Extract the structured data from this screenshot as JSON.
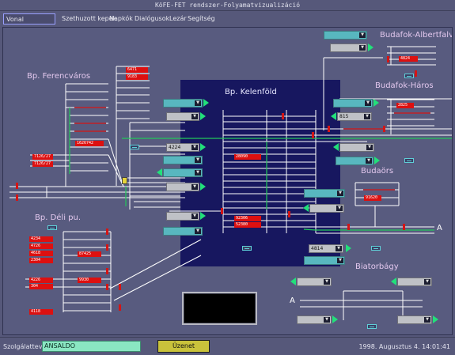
{
  "window": {
    "title": "KöFE-FET rendszer-Folyamatvizualizáció"
  },
  "menu": [
    {
      "label": "Vonal szakaszok",
      "active": true
    },
    {
      "label": "Szethuzott kepek"
    },
    {
      "label": "Napkók"
    },
    {
      "label": "Dialógusok"
    },
    {
      "label": "Lezár"
    },
    {
      "label": "Segítség"
    }
  ],
  "stations": {
    "ferencvaros": "Bp. Ferencváros",
    "kelenfold": "Bp. Kelenföld",
    "deli": "Bp. Déli pu.",
    "albertfalva": "Budafok-Albertfalva",
    "haros": "Budafok-Háros",
    "budaors": "Budaörs",
    "biatorbagy": "Biatorbágy"
  },
  "train_numbers": {
    "ferenc_top1": "6471",
    "ferenc_top2": "9183",
    "ferenc_mid": "1626742",
    "ferenc_left1": "7126/27",
    "ferenc_left2": "7126/27",
    "deli_1": "4234",
    "deli_2": "4726",
    "deli_3": "4618",
    "deli_4": "2304",
    "deli_5": "87425",
    "deli_6": "4226",
    "deli_7": "304",
    "deli_8": "9930",
    "deli_9": "4118",
    "kel_1": "28090",
    "kel_2": "92306",
    "kel_3": "52380",
    "albertfalva": "4824",
    "haros": "2825",
    "budaors": "91620"
  },
  "dropdowns": {
    "kel_4224": "4224",
    "haros_815": "815",
    "budaors_4814": "4814"
  },
  "marker_a": "A",
  "status": {
    "operator_label": "Szolgálattevő:",
    "operator_value": "ANSALDO",
    "message_button": "Üzenet",
    "datetime": "1998. Augusztus  4. 14:01:41"
  },
  "colors": {
    "kelenfold_box": "#17175f",
    "track": "#ffffff",
    "occupied": "#dd1010",
    "route": "#22c85a",
    "signal": "#22e07a"
  }
}
